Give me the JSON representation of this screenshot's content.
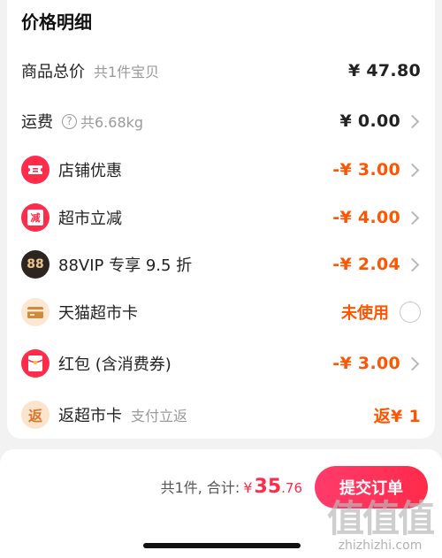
{
  "header": {
    "title": "价格明细"
  },
  "rows": [
    {
      "label": "商品总价",
      "sub": "共1件宝贝",
      "value": "¥ 47.80"
    },
    {
      "label": "运费",
      "sub": "共6.68kg",
      "value": "¥ 0.00",
      "help_icon": "question-circle-icon"
    },
    {
      "label": "店铺优惠",
      "value": "-¥ 3.00",
      "icon": "ticket-icon"
    },
    {
      "label": "超市立减",
      "value": "-¥ 4.00",
      "icon": "reduce-icon",
      "icon_text": "减"
    },
    {
      "label": "88VIP 专享 9.5 折",
      "value": "-¥ 2.04",
      "icon": "vip88-icon",
      "icon_text": "88"
    },
    {
      "label": "天猫超市卡",
      "value": "未使用",
      "icon": "card-icon"
    },
    {
      "label": "红包 (含消费券)",
      "value": "-¥ 3.00",
      "icon": "red-envelope-icon"
    },
    {
      "label": "返超市卡",
      "sub": "支付立返",
      "value": "返¥ 1",
      "icon": "return-icon",
      "icon_text": "返"
    }
  ],
  "footer": {
    "count_label": "共1件, 合计:",
    "currency": "¥",
    "total_int": "35",
    "total_dec": ".76",
    "submit_label": "提交订单"
  },
  "watermark": {
    "logo": "值值值",
    "url": "zhizhizhi.com"
  },
  "colors": {
    "accent": "#ff5500",
    "brand": "#ff2b4a"
  }
}
